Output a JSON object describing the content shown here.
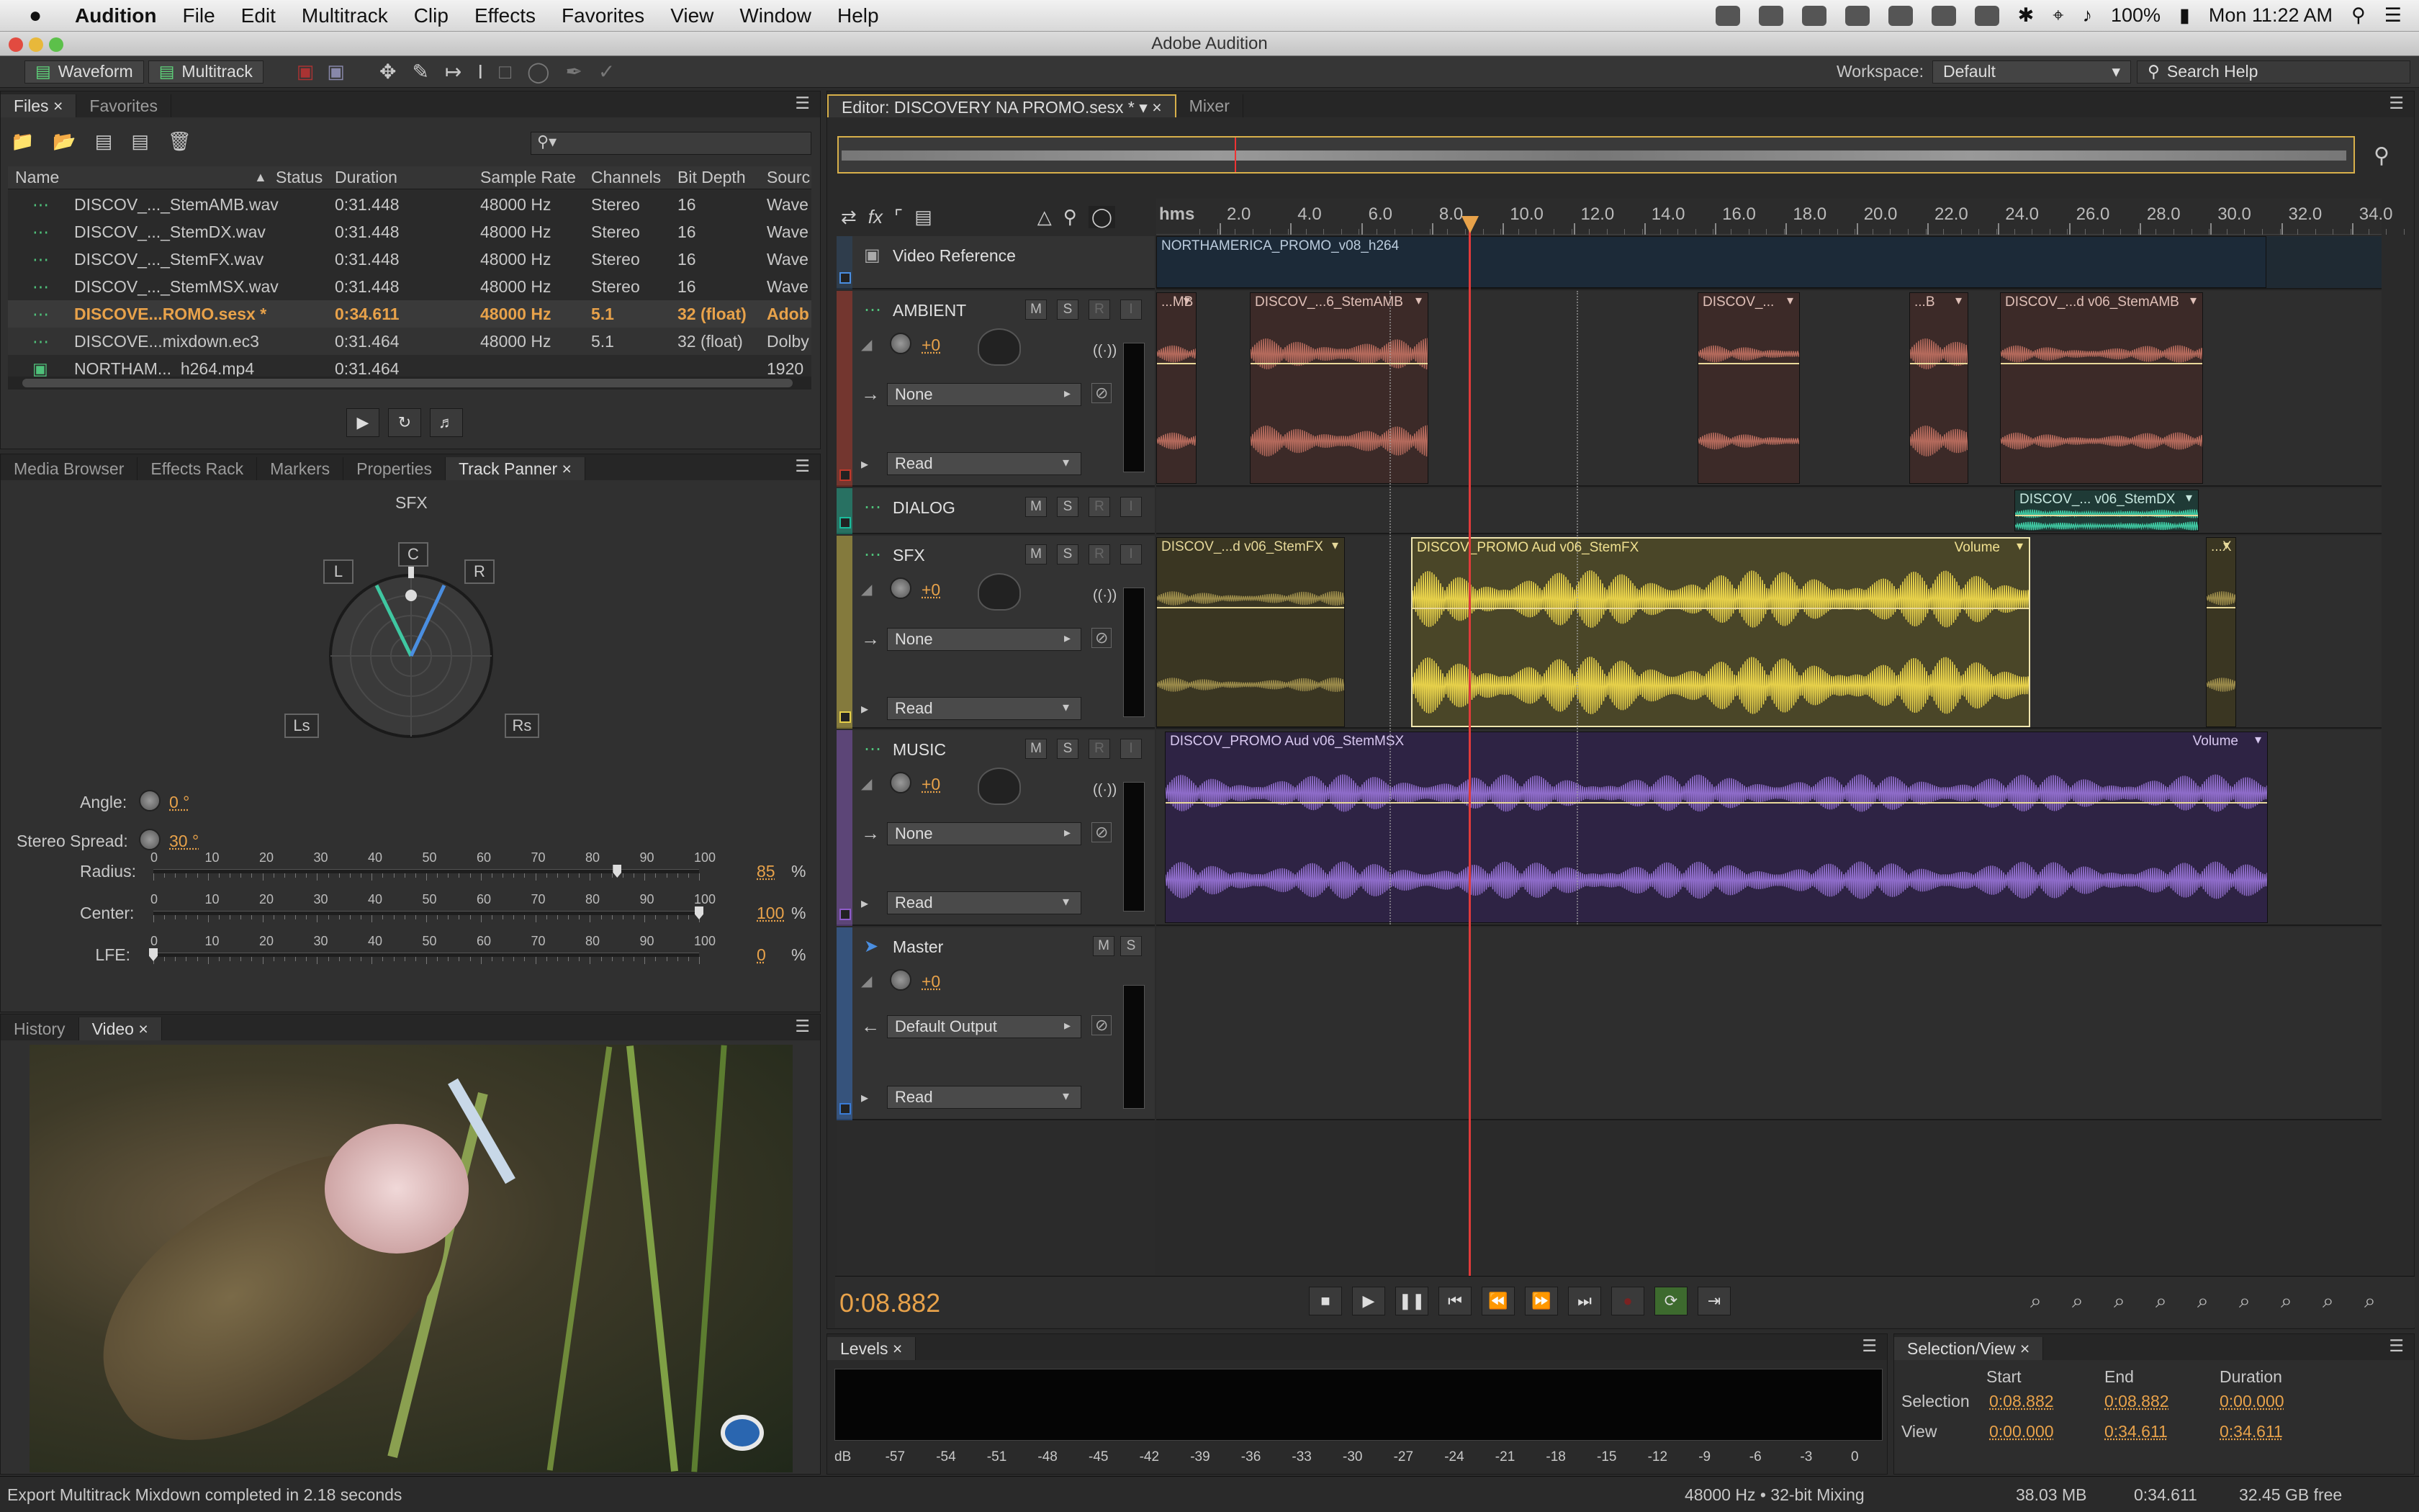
{
  "menubar": {
    "app": "Audition",
    "items": [
      "File",
      "Edit",
      "Multitrack",
      "Clip",
      "Effects",
      "Favorites",
      "View",
      "Window",
      "Help"
    ],
    "battery": "100%",
    "clock": "Mon 11:22 AM"
  },
  "window": {
    "title": "Adobe Audition"
  },
  "toolbar": {
    "waveform_label": "Waveform",
    "multitrack_label": "Multitrack",
    "workspace_label": "Workspace:",
    "workspace_value": "Default",
    "search_placeholder": "Search Help"
  },
  "files_panel": {
    "tabs": [
      "Files",
      "Favorites"
    ],
    "columns": [
      "Name",
      "Status",
      "Duration",
      "Sample Rate",
      "Channels",
      "Bit Depth",
      "Sourc"
    ],
    "rows": [
      {
        "name": "DISCOV_..._StemAMB.wav",
        "status": "",
        "duration": "0:31.448",
        "rate": "48000 Hz",
        "channels": "Stereo",
        "depth": "16",
        "source": "Wave"
      },
      {
        "name": "DISCOV_..._StemDX.wav",
        "status": "",
        "duration": "0:31.448",
        "rate": "48000 Hz",
        "channels": "Stereo",
        "depth": "16",
        "source": "Wave"
      },
      {
        "name": "DISCOV_..._StemFX.wav",
        "status": "",
        "duration": "0:31.448",
        "rate": "48000 Hz",
        "channels": "Stereo",
        "depth": "16",
        "source": "Wave"
      },
      {
        "name": "DISCOV_..._StemMSX.wav",
        "status": "",
        "duration": "0:31.448",
        "rate": "48000 Hz",
        "channels": "Stereo",
        "depth": "16",
        "source": "Wave"
      },
      {
        "name": "DISCOVE...ROMO.sesx *",
        "status": "",
        "duration": "0:34.611",
        "rate": "48000 Hz",
        "channels": "5.1",
        "depth": "32 (float)",
        "source": "Adob"
      },
      {
        "name": "DISCOVE...mixdown.ec3",
        "status": "",
        "duration": "0:31.464",
        "rate": "48000 Hz",
        "channels": "5.1",
        "depth": "32 (float)",
        "source": "Dolby"
      },
      {
        "name": "NORTHAM..._h264.mp4",
        "status": "",
        "duration": "0:31.464",
        "rate": "",
        "channels": "",
        "depth": "",
        "source": "1920"
      }
    ]
  },
  "panner_panel": {
    "tabs": [
      "Media Browser",
      "Effects Rack",
      "Markers",
      "Properties",
      "Track Panner"
    ],
    "track": "SFX",
    "speakers": {
      "l": "L",
      "c": "C",
      "r": "R",
      "ls": "Ls",
      "rs": "Rs"
    },
    "angle_label": "Angle:",
    "angle_value": "0 °",
    "spread_label": "Stereo Spread:",
    "spread_value": "30 °",
    "sliders": [
      {
        "label": "Radius:",
        "value": "85",
        "unit": "%",
        "level": 85
      },
      {
        "label": "Center:",
        "value": "100",
        "unit": "%",
        "level": 100
      },
      {
        "label": "LFE:",
        "value": "0",
        "unit": "%",
        "level": 0
      }
    ],
    "ticks": [
      "0",
      "10",
      "20",
      "30",
      "40",
      "50",
      "60",
      "70",
      "80",
      "90",
      "100"
    ]
  },
  "video_panel": {
    "tabs": [
      "History",
      "Video"
    ]
  },
  "editor": {
    "tab_label": "Editor: DISCOVERY NA PROMO.sesx *",
    "mixer_label": "Mixer",
    "ruler_unit": "hms",
    "ruler_ticks": [
      "2.0",
      "4.0",
      "6.0",
      "8.0",
      "10.0",
      "12.0",
      "14.0",
      "16.0",
      "18.0",
      "20.0",
      "22.0",
      "24.0",
      "26.0",
      "28.0",
      "30.0",
      "32.0",
      "34.0"
    ],
    "tracks": [
      {
        "name": "Video Reference",
        "clip": "NORTHAMERICA_PROMO_v08_h264"
      },
      {
        "name": "AMBIENT",
        "volume": "+0",
        "input": "None",
        "mode": "Read",
        "color": "#c0392b"
      },
      {
        "name": "DIALOG",
        "color": "#1abc9c"
      },
      {
        "name": "SFX",
        "volume": "+0",
        "input": "None",
        "mode": "Read",
        "color": "#e6d04a"
      },
      {
        "name": "MUSIC",
        "volume": "+0",
        "input": "None",
        "mode": "Read",
        "color": "#8e5cc9"
      },
      {
        "name": "Master",
        "volume": "+0",
        "output": "Default Output",
        "mode": "Read",
        "color": "#3a7bd5"
      }
    ],
    "clips": {
      "amb": [
        "...MB",
        "DISCOV_...6_StemAMB",
        "DISCOV_...",
        "...B",
        "DISCOV_...d v06_StemAMB"
      ],
      "dx": [
        "DISCOV_... v06_StemDX"
      ],
      "fx": [
        "DISCOV_...d v06_StemFX",
        "DISCOV_PROMO Aud v06_StemFX",
        "Volume",
        "...X"
      ],
      "msx": [
        "DISCOV_PROMO Aud v06_StemMSX",
        "Volume"
      ]
    },
    "btn_m": "M",
    "btn_s": "S",
    "btn_r": "R",
    "btn_i": "I",
    "time": "0:08.882"
  },
  "levels_panel": {
    "title": "Levels",
    "ticks": [
      "dB",
      "-57",
      "-54",
      "-51",
      "-48",
      "-45",
      "-42",
      "-39",
      "-36",
      "-33",
      "-30",
      "-27",
      "-24",
      "-21",
      "-18",
      "-15",
      "-12",
      "-9",
      "-6",
      "-3",
      "0"
    ]
  },
  "selection_panel": {
    "title": "Selection/View",
    "cols": [
      "Start",
      "End",
      "Duration"
    ],
    "selection_label": "Selection",
    "selection": [
      "0:08.882",
      "0:08.882",
      "0:00.000"
    ],
    "view_label": "View",
    "view": [
      "0:00.000",
      "0:34.611",
      "0:34.611"
    ]
  },
  "status": {
    "message": "Export Multitrack Mixdown completed in 2.18 seconds",
    "format": "48000 Hz • 32-bit Mixing",
    "memory": "38.03 MB",
    "duration": "0:34.611",
    "free": "32.45 GB free"
  }
}
